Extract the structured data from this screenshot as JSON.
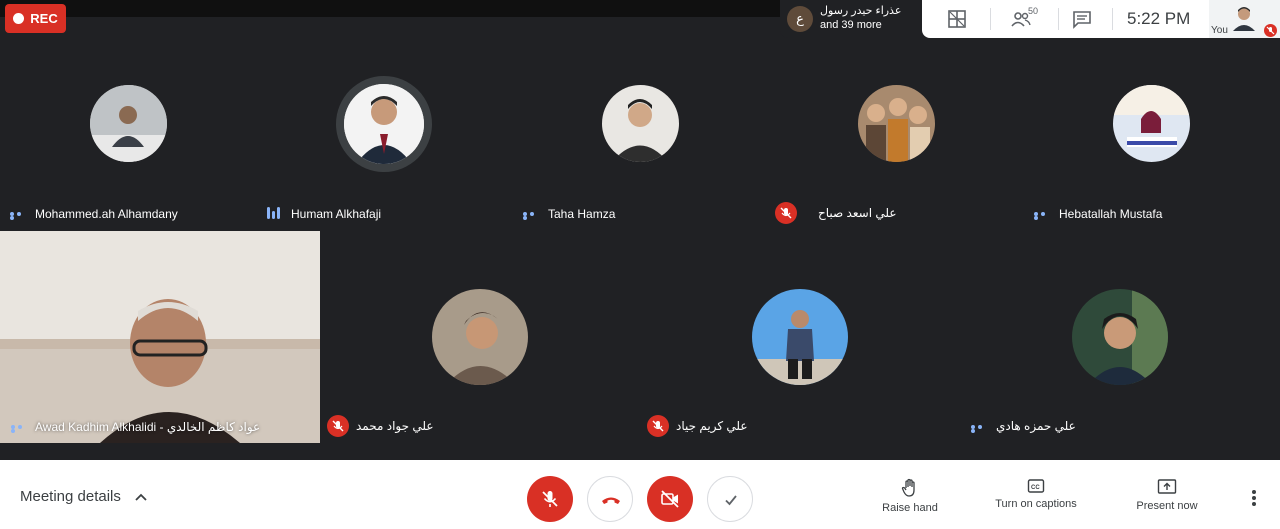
{
  "recording": {
    "label": "REC"
  },
  "notification": {
    "badge": "ع",
    "line1": "عذراء حيدر رسول",
    "line2": "and 39 more"
  },
  "topbar": {
    "participant_count": "50",
    "time": "5:22 PM",
    "self_label": "You"
  },
  "participants": [
    {
      "name": "Mohammed.ah Alhamdany",
      "status": "dots"
    },
    {
      "name": "Humam Alkhafaji",
      "status": "speaking"
    },
    {
      "name": "Taha Hamza",
      "status": "dots"
    },
    {
      "name": "علي اسعد صباح",
      "status": "muted"
    },
    {
      "name": "Hebatallah Mustafa",
      "status": "dots"
    },
    {
      "name": "عواد كاظم الخالدي - Awad Kadhim Alkhalidi",
      "status": "dots"
    },
    {
      "name": "علي جواد محمد",
      "status": "muted"
    },
    {
      "name": "علي كريم جياد",
      "status": "muted"
    },
    {
      "name": "علي حمزه هادي",
      "status": "dots"
    }
  ],
  "bottombar": {
    "meeting_details": "Meeting details",
    "raise_hand": "Raise hand",
    "captions": "Turn on captions",
    "present": "Present now"
  },
  "icons": {
    "rec": "record-dot-icon",
    "layout": "grid-layout-icon",
    "people": "people-icon",
    "chat": "chat-icon",
    "mic_off": "mic-off-icon",
    "hangup": "hang-up-icon",
    "cam_off": "camera-off-icon",
    "check": "checkmark-icon",
    "hand": "hand-icon",
    "cc": "captions-icon",
    "present": "present-screen-icon",
    "more": "more-vert-icon"
  },
  "colors": {
    "stage": "#202124",
    "muted_red": "#d93025",
    "accent_blue": "#8ab4f8"
  }
}
